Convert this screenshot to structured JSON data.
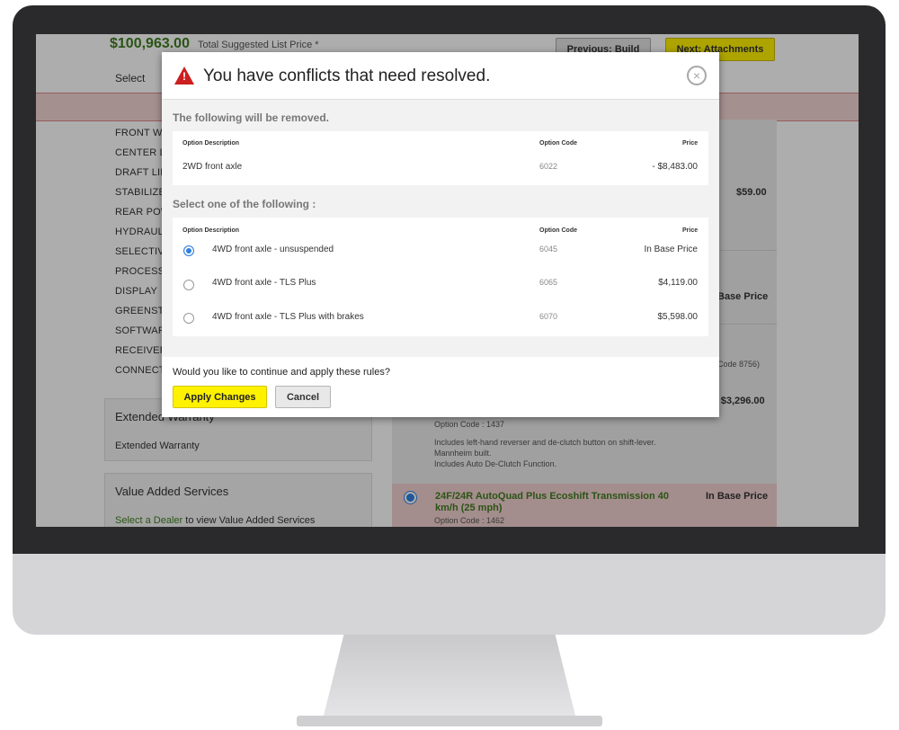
{
  "background": {
    "total_price": "$100,963.00",
    "total_price_label": "Total Suggested List Price *",
    "previous_button": "Previous: Build",
    "next_button": "Next: Attachments",
    "tab_select": "Select",
    "option_list": [
      "FRONT WH",
      "CENTER L",
      "DRAFT LIN",
      "STABILIZE",
      "REAR POW",
      "HYDRAULI",
      "SELECTIV",
      "PROCESS",
      "DISPLAY",
      "GREENSTA",
      "SOFTWAR",
      "RECEIVER",
      "CONNECT"
    ],
    "right_prices": [
      "$59.00",
      "Base Price",
      "Code 8756)",
      "- $3,296.00"
    ],
    "option_code_1437": "Option Code : 1437",
    "desc_lines": [
      "Includes left-hand reverser and de-clutch button on shift-lever.",
      "Mannheim built.",
      "Includes Auto De-Clutch Function."
    ],
    "extended_warranty_title": "Extended Warranty",
    "extended_warranty_item": "Extended Warranty",
    "vas_title": "Value Added Services",
    "vas_link": "Select a Dealer",
    "vas_text": " to view Value Added Services",
    "transmission_name": "24F/24R AutoQuad Plus Ecoshift Transmission 40 km/h (25 mph)",
    "transmission_price": "In Base Price",
    "transmission_code": "Option Code : 1462"
  },
  "modal": {
    "title": "You have conflicts that need resolved.",
    "removed_section": "The following will be removed.",
    "select_section": "Select one of the following :",
    "col_desc": "Option Description",
    "col_code": "Option Code",
    "col_price": "Price",
    "removed": [
      {
        "desc": "2WD front axle",
        "code": "6022",
        "price": "- $8,483.00"
      }
    ],
    "choices": [
      {
        "desc": "4WD front axle - unsuspended",
        "code": "6045",
        "price": "In Base Price",
        "selected": true
      },
      {
        "desc": "4WD front axle - TLS Plus",
        "code": "6065",
        "price": "$4,119.00",
        "selected": false
      },
      {
        "desc": "4WD front axle - TLS Plus with brakes",
        "code": "6070",
        "price": "$5,598.00",
        "selected": false
      }
    ],
    "question": "Would you like to continue and apply these rules?",
    "apply_label": "Apply Changes",
    "cancel_label": "Cancel"
  },
  "icons": {
    "warning": "warning-icon",
    "close": "close-icon"
  },
  "colors": {
    "accent_yellow": "#fff200",
    "brand_green": "#3f7d1f",
    "warning_red": "#cc1f1f",
    "radio_blue": "#2f80e0"
  }
}
